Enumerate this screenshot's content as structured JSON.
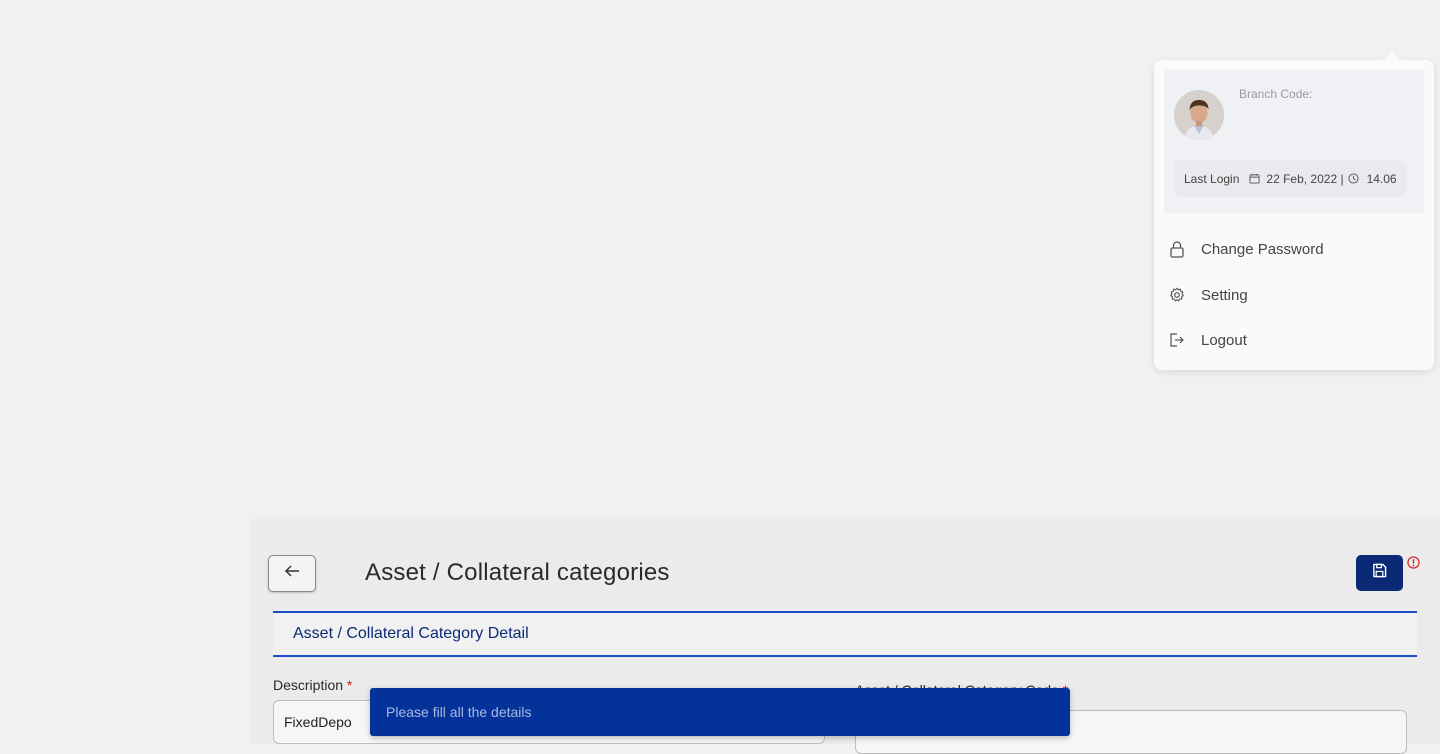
{
  "profile": {
    "branch_code_label": "Branch Code:",
    "last_login_label": "Last Login",
    "last_login_date": "22 Feb, 2022 |",
    "last_login_time": "14.06",
    "menu": [
      {
        "label": "Change Password",
        "icon": "lock-icon"
      },
      {
        "label": "Setting",
        "icon": "gear-icon"
      },
      {
        "label": "Logout",
        "icon": "logout-icon"
      }
    ]
  },
  "page": {
    "title": "Asset / Collateral categories",
    "section_title": "Asset / Collateral Category Detail",
    "fields": {
      "description_label": "Description",
      "description_value": "FixedDepo",
      "code_label": "Asset / Collateral Category Code",
      "required_mark": "*"
    }
  },
  "toast": {
    "message": "Please fill all the details"
  },
  "colors": {
    "primary": "#0a2a75",
    "accent_line": "#1f4fc8",
    "toast_bg": "#03339a",
    "error": "#d21a1a"
  }
}
